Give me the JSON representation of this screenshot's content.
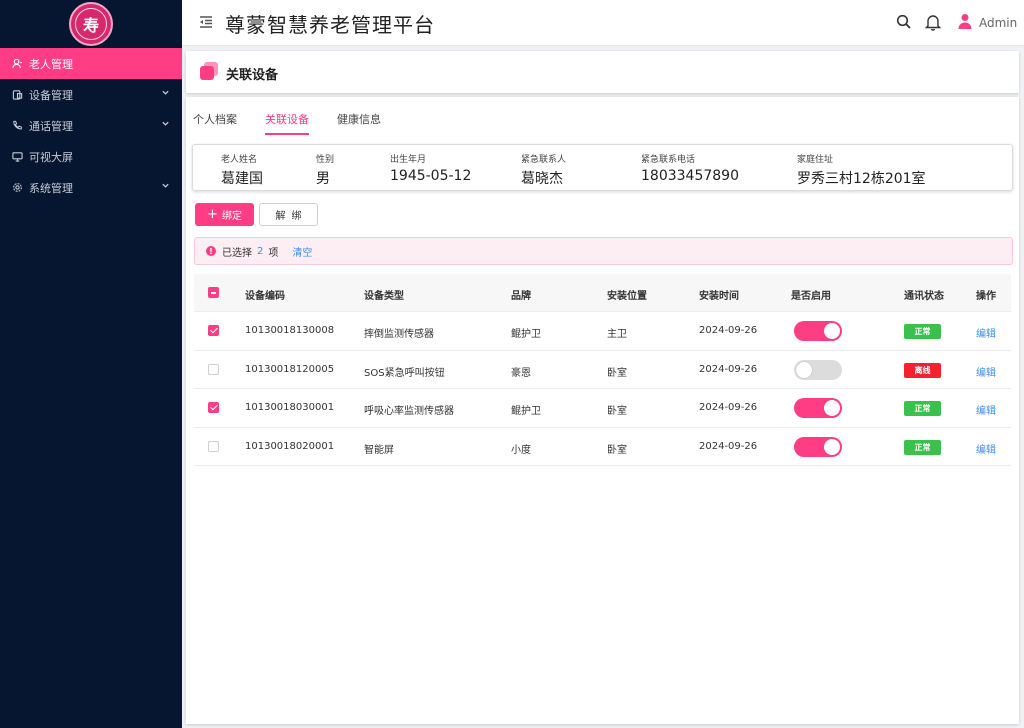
{
  "logo": {
    "glyph": "寿"
  },
  "sidebar": {
    "items": [
      {
        "label": "老人管理",
        "icon": "person-icon",
        "active": true,
        "expandable": false
      },
      {
        "label": "设备管理",
        "icon": "device-icon",
        "active": false,
        "expandable": true
      },
      {
        "label": "通话管理",
        "icon": "phone-icon",
        "active": false,
        "expandable": true
      },
      {
        "label": "可视大屏",
        "icon": "monitor-icon",
        "active": false,
        "expandable": false
      },
      {
        "label": "系统管理",
        "icon": "gear-icon",
        "active": false,
        "expandable": true
      }
    ]
  },
  "header": {
    "title": "尊蒙智慧养老管理平台",
    "user_name": "Admin"
  },
  "page": {
    "title": "关联设备"
  },
  "tabs": [
    "个人档案",
    "关联设备",
    "健康信息"
  ],
  "active_tab": 1,
  "elder": {
    "name_label": "老人姓名",
    "name": "葛建国",
    "gender_label": "性别",
    "gender": "男",
    "birth_label": "出生年月",
    "birth": "1945-05-12",
    "contact_label": "紧急联系人",
    "contact": "葛晓杰",
    "phone_label": "紧急联系电话",
    "phone": "18033457890",
    "address_label": "家庭住址",
    "address": "罗秀三村12栋201室"
  },
  "actions": {
    "bind_label": "绑定",
    "unbind_label": "解绑"
  },
  "selection": {
    "prefix": "已选择",
    "count": "2",
    "suffix": "项",
    "clear_label": "清空"
  },
  "table": {
    "headers": [
      "设备编码",
      "设备类型",
      "品牌",
      "安装位置",
      "安装时间",
      "是否启用",
      "通讯状态",
      "操作"
    ],
    "rows": [
      {
        "checked": true,
        "code": "10130018130008",
        "type": "摔倒监测传感器",
        "brand": "鲲护卫",
        "location": "主卫",
        "date": "2024-09-26",
        "enabled": true,
        "status": "正常",
        "status_ok": true,
        "op": "编辑"
      },
      {
        "checked": false,
        "code": "10130018120005",
        "type": "SOS紧急呼叫按钮",
        "brand": "豪恩",
        "location": "卧室",
        "date": "2024-09-26",
        "enabled": false,
        "status": "离线",
        "status_ok": false,
        "op": "编辑"
      },
      {
        "checked": true,
        "code": "10130018030001",
        "type": "呼吸心率监测传感器",
        "brand": "鲲护卫",
        "location": "卧室",
        "date": "2024-09-26",
        "enabled": true,
        "status": "正常",
        "status_ok": true,
        "op": "编辑"
      },
      {
        "checked": false,
        "code": "10130018020001",
        "type": "智能屏",
        "brand": "小度",
        "location": "卧室",
        "date": "2024-09-26",
        "enabled": true,
        "status": "正常",
        "status_ok": true,
        "op": "编辑"
      }
    ]
  },
  "colors": {
    "accent": "#ff3d84",
    "sidebar_bg": "#061630",
    "link": "#3d8ef0",
    "status_ok": "#3bbf4d",
    "status_bad": "#f5222d"
  }
}
